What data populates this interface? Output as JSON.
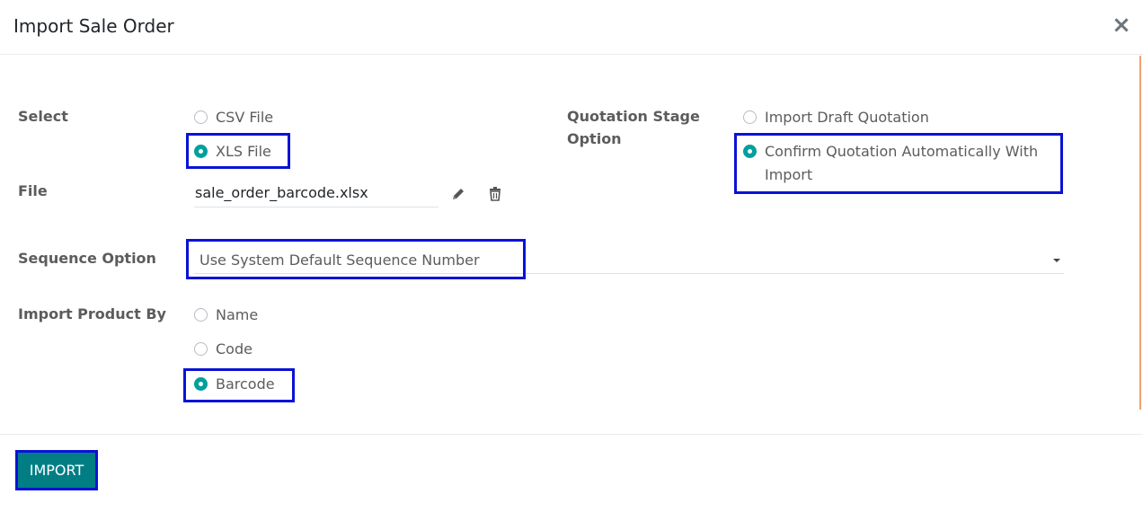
{
  "dialog": {
    "title": "Import Sale Order",
    "close_symbol": "×"
  },
  "form": {
    "select": {
      "label": "Select",
      "options": [
        {
          "label": "CSV File",
          "checked": false
        },
        {
          "label": "XLS File",
          "checked": true
        }
      ]
    },
    "file": {
      "label": "File",
      "value": "sale_order_barcode.xlsx",
      "icons": [
        "edit-icon",
        "trash-icon"
      ]
    },
    "quotation_stage": {
      "label_line1": "Quotation Stage",
      "label_line2": "Option",
      "options": [
        {
          "label": "Import Draft Quotation",
          "checked": false
        },
        {
          "label_line1": "Confirm Quotation Automatically With",
          "label_line2": "Import",
          "checked": true
        }
      ]
    },
    "sequence": {
      "label": "Sequence Option",
      "value": "Use System Default Sequence Number"
    },
    "import_product_by": {
      "label": "Import Product By",
      "options": [
        {
          "label": "Name",
          "checked": false
        },
        {
          "label": "Code",
          "checked": false
        },
        {
          "label": "Barcode",
          "checked": true
        }
      ]
    }
  },
  "footer": {
    "import_label": "IMPORT"
  },
  "colors": {
    "accent": "#00a09d",
    "button": "#017e84",
    "highlight": "#0a12d6",
    "scroll_indicator": "#f0a277"
  }
}
